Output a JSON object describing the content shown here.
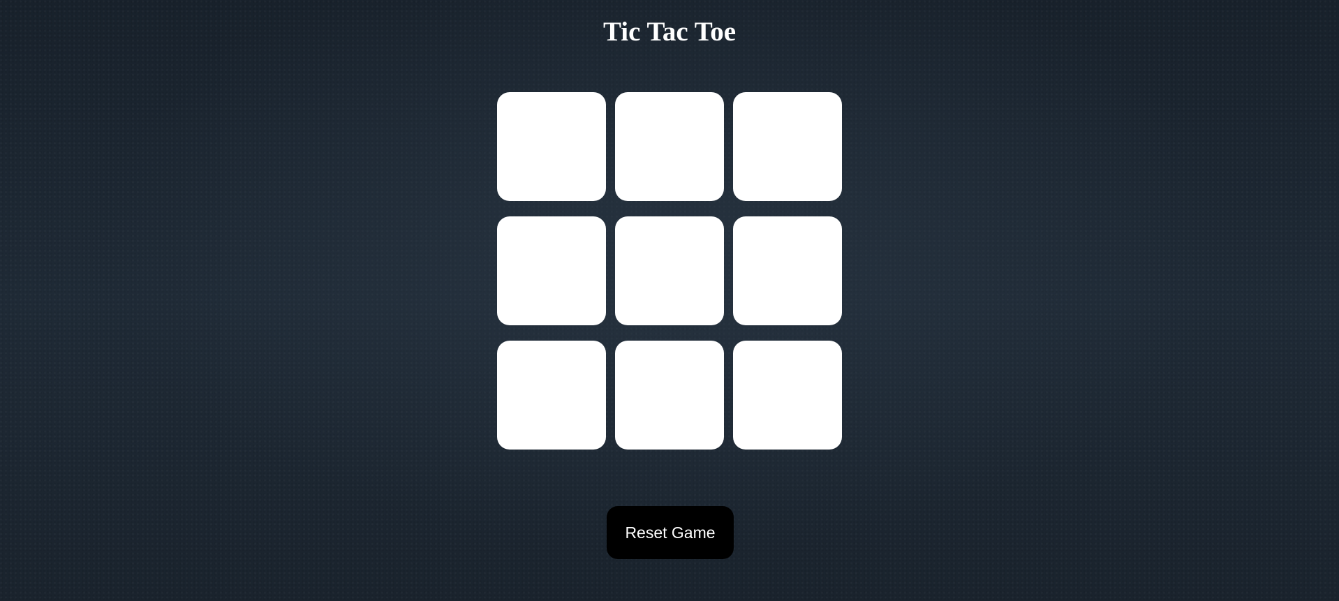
{
  "title": "Tic Tac Toe",
  "board": {
    "cells": [
      "",
      "",
      "",
      "",
      "",
      "",
      "",
      "",
      ""
    ]
  },
  "reset_label": "Reset Game",
  "colors": {
    "background": "#1c2631",
    "cell": "#ffffff",
    "button": "#000000",
    "text": "#ffffff"
  }
}
